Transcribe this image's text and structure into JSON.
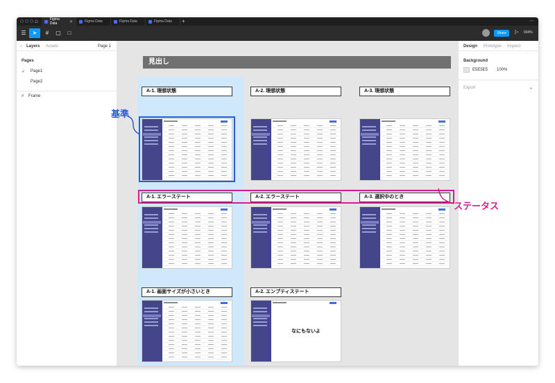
{
  "titlebar": {
    "tabs": [
      {
        "label": "Figma Data",
        "active": true
      },
      {
        "label": "Figma Data",
        "active": false
      },
      {
        "label": "Figma Data",
        "active": false
      },
      {
        "label": "Figma Data",
        "active": false
      }
    ]
  },
  "toolbar": {
    "share_label": "Share",
    "zoom": "994%"
  },
  "left_panel": {
    "tab_layers": "Layers",
    "tab_assets": "Assets",
    "page_selector": "Page 1",
    "pages_title": "Pages",
    "pages": [
      "Page1",
      "Page2"
    ],
    "layer": "Frame"
  },
  "right_panel": {
    "tab_design": "Design",
    "tab_prototype": "Prototype",
    "tab_inspect": "Inspect",
    "background_title": "Background",
    "background_hex": "E5E5E5",
    "background_opacity": "100%",
    "export_label": "Export"
  },
  "canvas": {
    "heading": "見出し",
    "labels": {
      "a1_ideal": "A-1. 理想状態",
      "a2_ideal": "A-2. 理想状態",
      "a3_ideal": "A-3. 理想状態",
      "a1_error": "A-1. エラーステート",
      "a2_error": "A-2. エラーステート",
      "a3_selecting": "A-3. 選択中のとき",
      "a1_small": "A-1. 画面サイズが小さいとき",
      "a2_empty": "A-2. エンプティステート"
    },
    "empty_message": "なにもないよ"
  },
  "annotations": {
    "baseline": "基準",
    "status": "ステータス"
  },
  "colors": {
    "accent": "#0d99ff",
    "baseline": "#2a5bd7",
    "status": "#d81b8a",
    "sidebar": "#44458a"
  }
}
